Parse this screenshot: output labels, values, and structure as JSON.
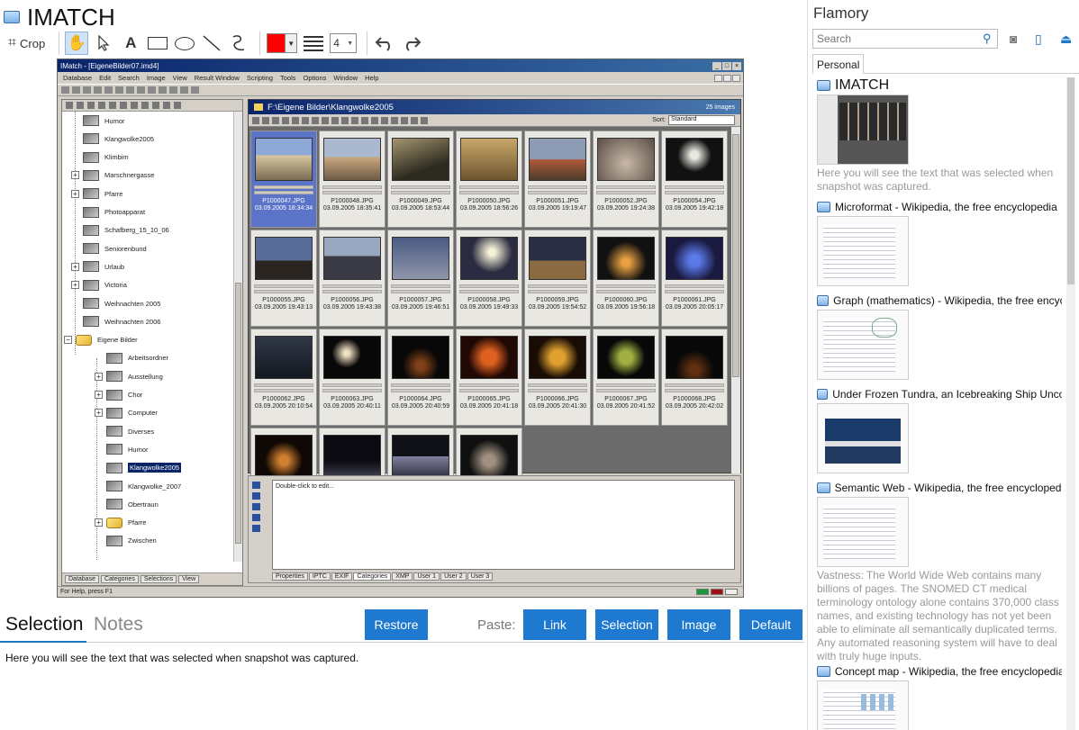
{
  "app": {
    "title": "IMATCH"
  },
  "toolbar": {
    "crop_label": "Crop",
    "text_tool_label": "A",
    "line_width_value": "4",
    "stroke_color": "#ff0000"
  },
  "screenshot": {
    "window_title": "IMatch - [EigeneBilder07.imd4]",
    "menu": [
      "Database",
      "Edit",
      "Search",
      "Image",
      "View",
      "Result Window",
      "Scripting",
      "Tools",
      "Options",
      "Window",
      "Help"
    ],
    "tree_items": [
      {
        "label": "Humor",
        "expander": false
      },
      {
        "label": "Klangwolke2005",
        "expander": false
      },
      {
        "label": "Klimbim",
        "expander": false
      },
      {
        "label": "Marschnergasse",
        "expander": true
      },
      {
        "label": "Pfarre",
        "expander": true
      },
      {
        "label": "Photoapparat",
        "expander": false
      },
      {
        "label": "Schafberg_15_10_06",
        "expander": false
      },
      {
        "label": "Seniorenbund",
        "expander": false
      },
      {
        "label": "Urlaub",
        "expander": true
      },
      {
        "label": "Victoria",
        "expander": true
      },
      {
        "label": "Weihnachten 2005",
        "expander": false
      },
      {
        "label": "Weihnachten 2006",
        "expander": false
      },
      {
        "label": "Eigene Bilder",
        "expander": "minus"
      },
      {
        "label": "Arbeitsordner",
        "expander": false
      },
      {
        "label": "Ausstellung",
        "expander": true
      },
      {
        "label": "Chor",
        "expander": true
      },
      {
        "label": "Computer",
        "expander": true
      },
      {
        "label": "Diverses",
        "expander": false
      },
      {
        "label": "Humor",
        "expander": false
      },
      {
        "label": "Klangwolke2005",
        "expander": false,
        "selected": true
      },
      {
        "label": "Klangwolke_2007",
        "expander": false
      },
      {
        "label": "Obertraun",
        "expander": false
      },
      {
        "label": "Pfarre",
        "expander": true
      },
      {
        "label": "Zwischen",
        "expander": false
      }
    ],
    "tree_tabs": [
      "Database",
      "Categories",
      "Selections",
      "View"
    ],
    "path": "F:\\Eigene Bilder\\Klangwolke2005",
    "image_count": "25 images",
    "sort_label": "Sort:",
    "sort_value": "Standard",
    "thumbnails": [
      {
        "file": "P1000047.JPG",
        "date": "03.09.2005 18:34:34",
        "selected": true
      },
      {
        "file": "P1000048.JPG",
        "date": "03.09.2005 18:35:41"
      },
      {
        "file": "P1000049.JPG",
        "date": "03.09.2005 18:53:44"
      },
      {
        "file": "P1000050.JPG",
        "date": "03.09.2005 18:56:26"
      },
      {
        "file": "P1000051.JPG",
        "date": "03.09.2005 19:19:47"
      },
      {
        "file": "P1000052.JPG",
        "date": "03.09.2005 19:24:38"
      },
      {
        "file": "P1000054.JPG",
        "date": "03.09.2005 19:42:18"
      },
      {
        "file": "P1000055.JPG",
        "date": "03.09.2005 19:43:13"
      },
      {
        "file": "P1000056.JPG",
        "date": "03.09.2005 19:43:38"
      },
      {
        "file": "P1000057.JPG",
        "date": "03.09.2005 19:46:51"
      },
      {
        "file": "P1000058.JPG",
        "date": "03.09.2005 19:49:33"
      },
      {
        "file": "P1000059.JPG",
        "date": "03.09.2005 19:54:52"
      },
      {
        "file": "P1000060.JPG",
        "date": "03.09.2005 19:56:18"
      },
      {
        "file": "P1000061.JPG",
        "date": "03.09.2005 20:05:17"
      },
      {
        "file": "P1000062.JPG",
        "date": "03.09.2005 20:10:54"
      },
      {
        "file": "P1000063.JPG",
        "date": "03.09.2005 20:40:11"
      },
      {
        "file": "P1000064.JPG",
        "date": "03.09.2005 20:40:59"
      },
      {
        "file": "P1000065.JPG",
        "date": "03.09.2005 20:41:18"
      },
      {
        "file": "P1000066.JPG",
        "date": "03.09.2005 20:41:30"
      },
      {
        "file": "P1000067.JPG",
        "date": "03.09.2005 20:41:52"
      },
      {
        "file": "P1000068.JPG",
        "date": "03.09.2005 20:42:02"
      },
      {
        "file": "",
        "date": ""
      },
      {
        "file": "",
        "date": ""
      },
      {
        "file": "",
        "date": ""
      },
      {
        "file": "",
        "date": ""
      }
    ],
    "editor_placeholder": "Double-click to edit...",
    "info_tabs": [
      "Properties",
      "IPTC",
      "EXIF",
      "Categories",
      "XMP",
      "User 1",
      "User 2",
      "User 3"
    ],
    "active_info_tab": "Categories",
    "status_text": "For Help, press F1"
  },
  "bottom": {
    "tab_selection": "Selection",
    "tab_notes": "Notes",
    "restore_label": "Restore",
    "paste_label": "Paste:",
    "link_label": "Link",
    "selection_label": "Selection",
    "image_label": "Image",
    "default_label": "Default",
    "selection_text": "Here you will see the text that was selected when snapshot was captured."
  },
  "sidebar": {
    "title": "Flamory",
    "search_placeholder": "Search",
    "tab_personal": "Personal",
    "items": [
      {
        "title": "IMATCH",
        "desc": "Here you will see the text that was selected when snapshot was captured."
      },
      {
        "title": "Microformat - Wikipedia, the free encyclopedia",
        "desc": ""
      },
      {
        "title": "Graph (mathematics) - Wikipedia, the free encyclopedia",
        "desc": ""
      },
      {
        "title": "Under Frozen Tundra, an Icebreaking Ship Uncovers Secrets",
        "desc": ""
      },
      {
        "title": "Semantic Web - Wikipedia, the free encyclopedia",
        "desc": "Vastness: The World Wide Web contains many billions of pages. The SNOMED CT medical terminology ontology alone contains 370,000 class names, and existing technology has not yet been able to eliminate all semantically duplicated terms. Any automated reasoning system will have to deal with truly huge inputs."
      },
      {
        "title": "Concept map - Wikipedia, the free encyclopedia",
        "desc": ""
      }
    ]
  }
}
